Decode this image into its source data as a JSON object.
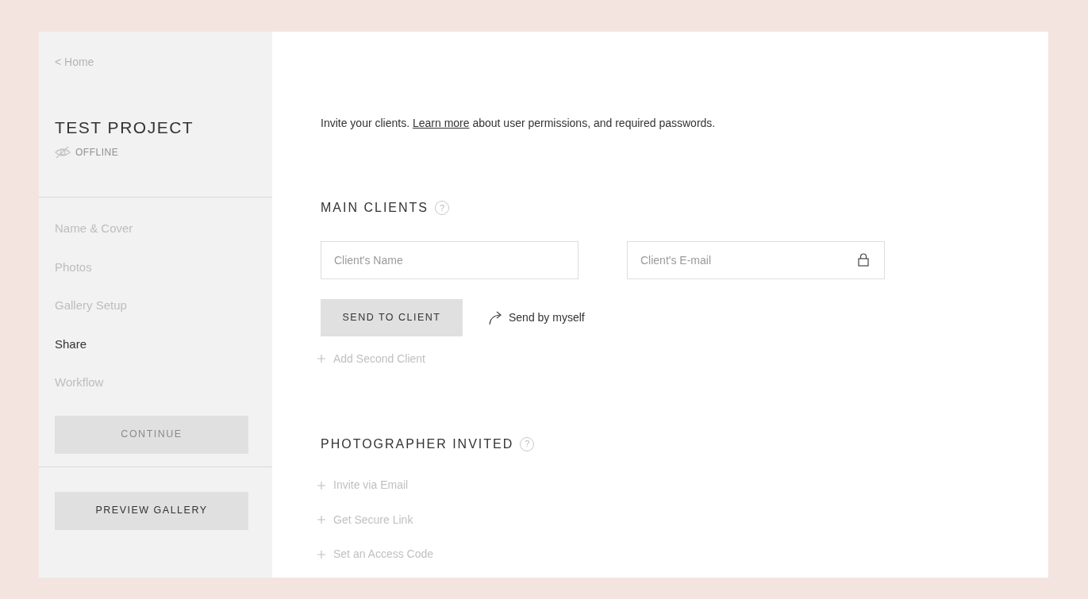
{
  "sidebar": {
    "back_link": "< Home",
    "project_title": "TEST PROJECT",
    "status": "OFFLINE",
    "items": [
      {
        "label": "Name & Cover",
        "selected": false
      },
      {
        "label": "Photos",
        "selected": false
      },
      {
        "label": "Gallery Setup",
        "selected": false
      },
      {
        "label": "Share",
        "selected": true
      },
      {
        "label": "Workflow",
        "selected": false
      }
    ],
    "continue_button": {
      "label": "CONTINUE",
      "disabled": true
    },
    "preview_button": "PREVIEW GALLERY"
  },
  "intro": {
    "before": "Invite your clients. ",
    "link": "Learn more",
    "after": " about user permissions, and required passwords."
  },
  "main_clients": {
    "heading": "MAIN CLIENTS",
    "help": "?",
    "name_field": {
      "placeholder": "Client's Name"
    },
    "email_field": {
      "placeholder": "Client's E-mail"
    },
    "send_button": "SEND TO CLIENT",
    "send_self": "Send by myself",
    "add_link": "Add Second Client"
  },
  "photographer_invited": {
    "heading": "PHOTOGRAPHER INVITED",
    "help": "?",
    "links": [
      "Invite via Email",
      "Get Secure Link",
      "Set an Access Code"
    ]
  }
}
